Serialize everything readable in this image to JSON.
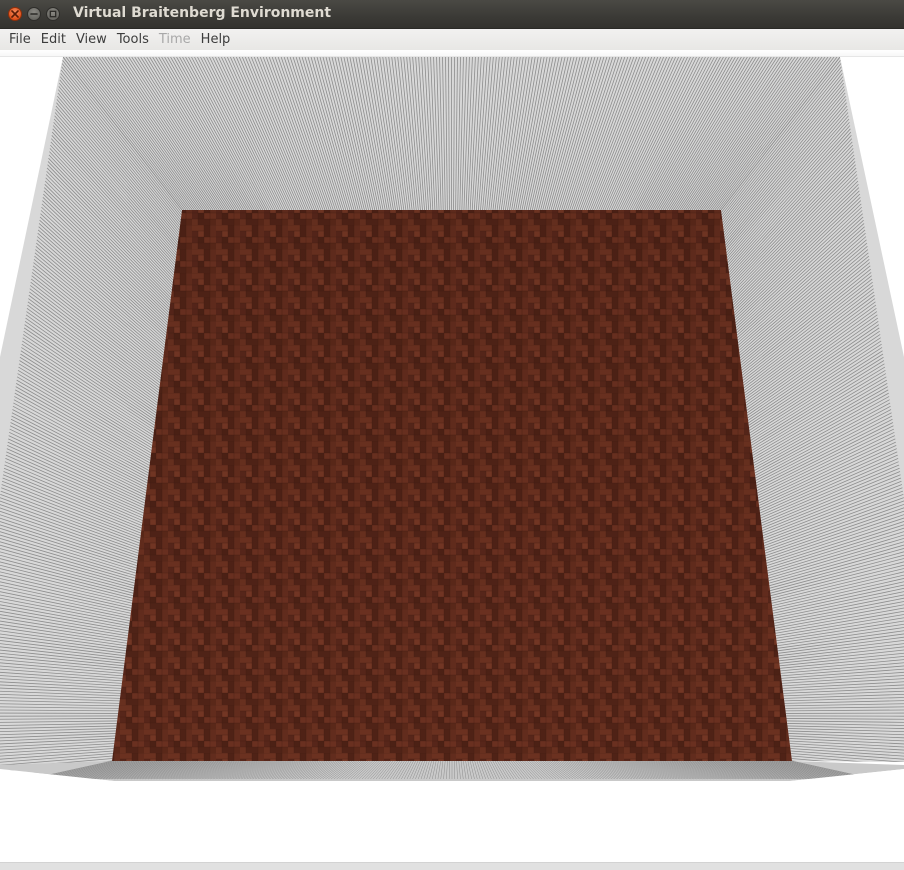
{
  "window": {
    "title": "Virtual Braitenberg Environment",
    "buttons": {
      "close_icon": "close-icon",
      "minimize_icon": "minimize-icon",
      "maximize_icon": "maximize-icon"
    }
  },
  "menubar": {
    "items": [
      {
        "label": "File",
        "enabled": true
      },
      {
        "label": "Edit",
        "enabled": true
      },
      {
        "label": "View",
        "enabled": true
      },
      {
        "label": "Tools",
        "enabled": true
      },
      {
        "label": "Time",
        "enabled": false
      },
      {
        "label": "Help",
        "enabled": true
      }
    ]
  },
  "scene": {
    "floor_texture": "herringbone-parquet",
    "wall_texture": "vertical-stripes",
    "colors": {
      "floor_base": "#5e2b1c",
      "floor_dark": "#4a2014",
      "floor_light": "#7a3a26",
      "wall_light": "#d8d8d8",
      "wall_dark": "#8c8c8c",
      "background": "#ffffff"
    }
  }
}
